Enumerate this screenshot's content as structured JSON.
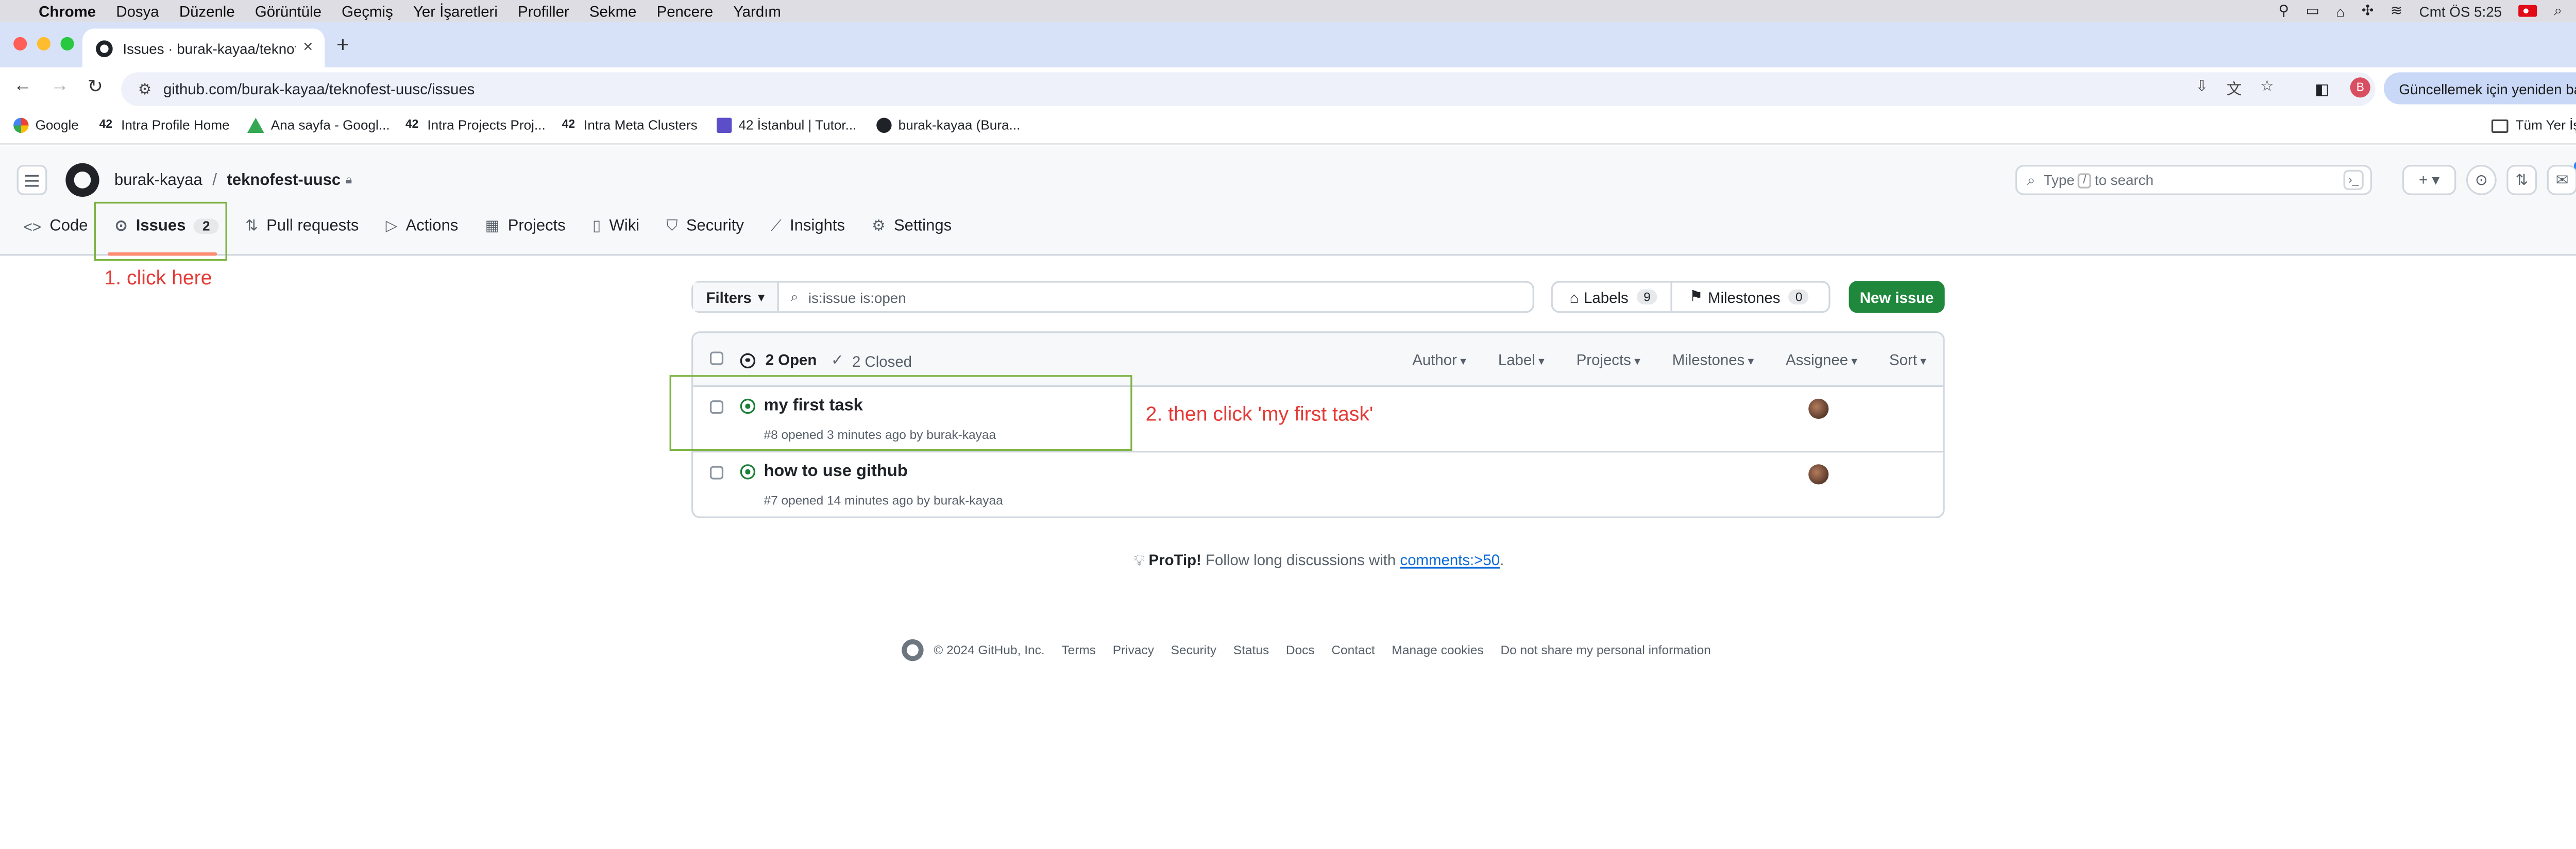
{
  "menubar": {
    "app": "Chrome",
    "items": [
      "Dosya",
      "Düzenle",
      "Görüntüle",
      "Geçmiş",
      "Yer İşaretleri",
      "Profiller",
      "Sekme",
      "Pencere",
      "Yardım"
    ],
    "clock": "Cmt ÖS 5:25"
  },
  "browser": {
    "tab_title": "Issues · burak-kayaa/teknofest-uusc",
    "url": "github.com/burak-kayaa/teknofest-uusc/issues",
    "update_label": "Güncellemek için yeniden başlat",
    "profile_initial": "B",
    "traffic_colors": [
      "#ff5f57",
      "#febc2e",
      "#28c840"
    ]
  },
  "bookmarks": {
    "items": [
      {
        "label": "Google",
        "icon": "google-icon"
      },
      {
        "label": "Intra Profile Home",
        "icon": "42-icon"
      },
      {
        "label": "Ana sayfa - Googl...",
        "icon": "drive-icon"
      },
      {
        "label": "Intra Projects Proj...",
        "icon": "42-icon"
      },
      {
        "label": "Intra Meta Clusters",
        "icon": "42-icon"
      },
      {
        "label": "42 İstanbul | Tutor...",
        "icon": "calendar-icon"
      },
      {
        "label": "burak-kayaa (Bura...",
        "icon": "github-icon"
      }
    ],
    "all_label": "Tüm Yer İşaretleri"
  },
  "github": {
    "owner": "burak-kayaa",
    "separator": "/",
    "repo": "teknofest-uusc",
    "search_prefix": "Type",
    "search_slash": "/",
    "search_suffix": "to search",
    "nav": [
      {
        "label": "Code",
        "icon": "code-icon"
      },
      {
        "label": "Issues",
        "icon": "issue-icon",
        "count": "2",
        "active": true
      },
      {
        "label": "Pull requests",
        "icon": "pull-request-icon"
      },
      {
        "label": "Actions",
        "icon": "play-icon"
      },
      {
        "label": "Projects",
        "icon": "table-icon"
      },
      {
        "label": "Wiki",
        "icon": "book-icon"
      },
      {
        "label": "Security",
        "icon": "shield-icon"
      },
      {
        "label": "Insights",
        "icon": "graph-icon"
      },
      {
        "label": "Settings",
        "icon": "gear-icon"
      }
    ],
    "filters_label": "Filters",
    "filter_query": "is:issue is:open",
    "labels_label": "Labels",
    "labels_count": "9",
    "milestones_label": "Milestones",
    "milestones_count": "0",
    "new_issue_label": "New issue",
    "open_label": "2 Open",
    "closed_label": "2 Closed",
    "sort_filters": [
      "Author",
      "Label",
      "Projects",
      "Milestones",
      "Assignee",
      "Sort"
    ],
    "issues": [
      {
        "title": "my first task",
        "meta": "#8 opened 3 minutes ago by burak-kayaa"
      },
      {
        "title": "how to use github",
        "meta": "#7 opened 14 minutes ago by burak-kayaa"
      }
    ],
    "protip_label": "ProTip!",
    "protip_text": "Follow long discussions with",
    "protip_link": "comments:>50",
    "protip_end": ".",
    "footer_copy": "© 2024 GitHub, Inc.",
    "footer_links": [
      "Terms",
      "Privacy",
      "Security",
      "Status",
      "Docs",
      "Contact",
      "Manage cookies",
      "Do not share my personal information"
    ]
  },
  "annotations": {
    "step1": "1. click here",
    "step2": "2. then click 'my first task'",
    "box_color": "#7cb342",
    "text_color": "#e53935"
  }
}
